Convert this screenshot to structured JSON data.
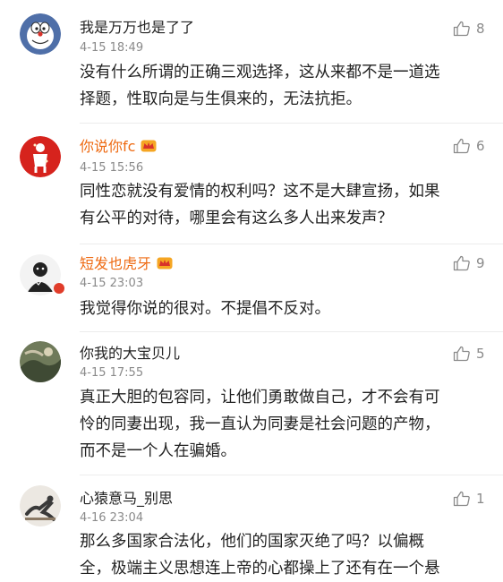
{
  "comments": [
    {
      "username": "我是万万也是了了",
      "time": "4-15 18:49",
      "likes": "8",
      "lines": [
        "没有什么所谓的正确三观选择，这从来都不是一道选",
        "择题，性取向是与生俱来的，无法抗拒。"
      ],
      "vip": false,
      "avatar_icon": "doraemon-avatar"
    },
    {
      "username": "你说你fc",
      "time": "4-15 15:56",
      "likes": "6",
      "lines": [
        "同性恋就没有爱情的权利吗？这不是大肆宣扬，如果",
        "有公平的对待，哪里会有这么多人出来发声？"
      ],
      "vip": true,
      "avatar_icon": "red-figure-avatar"
    },
    {
      "username": "短发也虎牙",
      "time": "4-15 23:03",
      "likes": "9",
      "lines": [
        "我觉得你说的很对。不提倡不反对。"
      ],
      "vip": true,
      "avatar_icon": "cartoon-avatar"
    },
    {
      "username": "你我的大宝贝儿",
      "time": "4-15 17:55",
      "likes": "5",
      "lines": [
        "真正大胆的包容同，让他们勇敢做自己，才不会有可",
        "怜的同妻出现，我一直认为同妻是社会问题的产物，",
        "而不是一个人在骗婚。"
      ],
      "vip": false,
      "avatar_icon": "scenery-avatar"
    },
    {
      "username": "心猿意马_别思",
      "time": "4-16 23:04",
      "likes": "1",
      "lines": [
        "那么多国家合法化，他们的国家灭绝了吗？以偏概",
        "全，极端主义思想连上帝的心都操上了还有在一个悬"
      ],
      "vip": false,
      "avatar_icon": "pose-avatar"
    }
  ],
  "colors": {
    "vip_name": "#ee6a12",
    "meta": "#8a8a8a",
    "text": "#222222"
  }
}
